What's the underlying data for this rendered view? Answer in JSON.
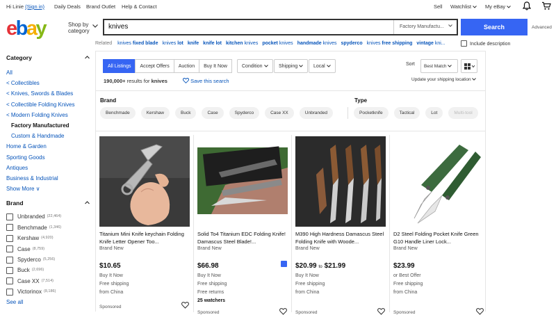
{
  "topbar": {
    "greeting": "Hi Linie",
    "signin": "(Sign in)",
    "daily_deals": "Daily Deals",
    "brand_outlet": "Brand Outlet",
    "help": "Help & Contact",
    "sell": "Sell",
    "watchlist": "Watchlist",
    "my_ebay": "My eBay"
  },
  "header": {
    "logo": {
      "e": "e",
      "b": "b",
      "a": "a",
      "y": "y"
    },
    "logo_colors": {
      "e": "#e53238",
      "b": "#0064d2",
      "a": "#f5af02",
      "y": "#86b817"
    },
    "shop_by_1": "Shop by",
    "shop_by_2": "category",
    "search_value": "knives",
    "category_select": "Factory Manufactu...",
    "search_button": "Search",
    "advanced": "Advanced",
    "include_description": "Include description"
  },
  "related": {
    "label": "Related",
    "links": [
      {
        "q": "knives",
        "b": "fixed blade",
        "boldfirst": false
      },
      {
        "q": "knives",
        "b": "lot",
        "boldfirst": false
      },
      {
        "q": "",
        "b": "knife",
        "boldfirst": false
      },
      {
        "q": "",
        "b": "knife lot",
        "boldfirst": false
      },
      {
        "q": "kitchen",
        "b": "knives",
        "boldfirst": true
      },
      {
        "q": "pocket",
        "b": "knives",
        "boldfirst": true
      },
      {
        "q": "handmade",
        "b": "knives",
        "boldfirst": true
      },
      {
        "q": "",
        "b": "spyderco",
        "boldfirst": false
      },
      {
        "q": "knives",
        "b": "free shipping",
        "boldfirst": false
      },
      {
        "q": "vintage",
        "b": "kni...",
        "boldfirst": true
      }
    ]
  },
  "sidebar": {
    "category_header": "Category",
    "categories": [
      {
        "label": "All",
        "type": "link"
      },
      {
        "label": "< Collectibles",
        "type": "link"
      },
      {
        "label": "< Knives, Swords & Blades",
        "type": "link"
      },
      {
        "label": "< Collectible Folding Knives",
        "type": "link"
      },
      {
        "label": "< Modern Folding Knives",
        "type": "link"
      },
      {
        "label": "Factory Manufactured",
        "type": "active"
      },
      {
        "label": "Custom & Handmade",
        "type": "indent"
      },
      {
        "label": "Home & Garden",
        "type": "link"
      },
      {
        "label": "Sporting Goods",
        "type": "link"
      },
      {
        "label": "Antiques",
        "type": "link"
      },
      {
        "label": "Business & Industrial",
        "type": "link"
      },
      {
        "label": "Show More ∨",
        "type": "link"
      }
    ],
    "brand_header": "Brand",
    "brands": [
      {
        "label": "Unbranded",
        "count": "(22,464)"
      },
      {
        "label": "Benchmade",
        "count": "(1,346)"
      },
      {
        "label": "Kershaw",
        "count": "(4,920)"
      },
      {
        "label": "Case",
        "count": "(8,759)"
      },
      {
        "label": "Spyderco",
        "count": "(5,256)"
      },
      {
        "label": "Buck",
        "count": "(2,696)"
      },
      {
        "label": "Case XX",
        "count": "(7,514)"
      },
      {
        "label": "Victorinox",
        "count": "(8,186)"
      }
    ],
    "see_all": "See all"
  },
  "toolbar": {
    "tabs": [
      "All Listings",
      "Accept Offers",
      "Auction",
      "Buy It Now"
    ],
    "condition": "Condition",
    "shipping": "Shipping",
    "local": "Local",
    "sort_label": "Sort",
    "sort_value": "Best Match",
    "results_count": "190,000+",
    "results_text": " results for ",
    "results_query": "knives",
    "save_search": "Save this search",
    "update_location": "Update your shipping location"
  },
  "aspects": {
    "brand_label": "Brand",
    "brand_pills": [
      "Benchmade",
      "Kershaw",
      "Buck",
      "Case",
      "Spyderco",
      "Case XX",
      "Unbranded"
    ],
    "type_label": "Type",
    "type_pills": [
      "Pocketknife",
      "Tactical",
      "Lot",
      "Multi-tool"
    ]
  },
  "items": [
    {
      "title": "Titanium Mini Knife keychain Folding Knife Letter Opener Too...",
      "condition": "Brand New",
      "price": "$10.65",
      "line1": "Buy It Now",
      "line2": "Free shipping",
      "line3": "from China",
      "sponsored": "Sponsored"
    },
    {
      "title": "Solid To4 Titanium EDC Folding Knife! Damascus Steel Blade!...",
      "condition": "Brand New",
      "price": "$66.98",
      "line1": "Buy It Now",
      "line2": "Free shipping",
      "line3": "Free returns",
      "line4": "25 watchers",
      "sponsored": "Sponsored"
    },
    {
      "title": "M390 High Hardness Damascus Steel Folding Knife with Woode...",
      "condition": "Brand New",
      "price": "$20.99",
      "price_to": "to",
      "price_high": "$21.99",
      "line1": "Buy It Now",
      "line2": "Free shipping",
      "line3": "from China",
      "sponsored": "Sponsored"
    },
    {
      "title": "D2 Steel Folding Pocket Knife Green G10 Handle Liner Lock...",
      "condition": "Brand New",
      "price": "$23.99",
      "line1": "or Best Offer",
      "line2": "Free shipping",
      "line3": "from China",
      "sponsored": "Sponsored"
    }
  ],
  "icons": {
    "bell": "bell-icon",
    "cart": "cart-icon",
    "heart": "heart-icon",
    "chevron": "chevron-down-icon",
    "grid": "grid-view-icon",
    "save": "heart-outline-icon"
  },
  "colors": {
    "accent": "#3665f3",
    "link": "#0654ba"
  }
}
